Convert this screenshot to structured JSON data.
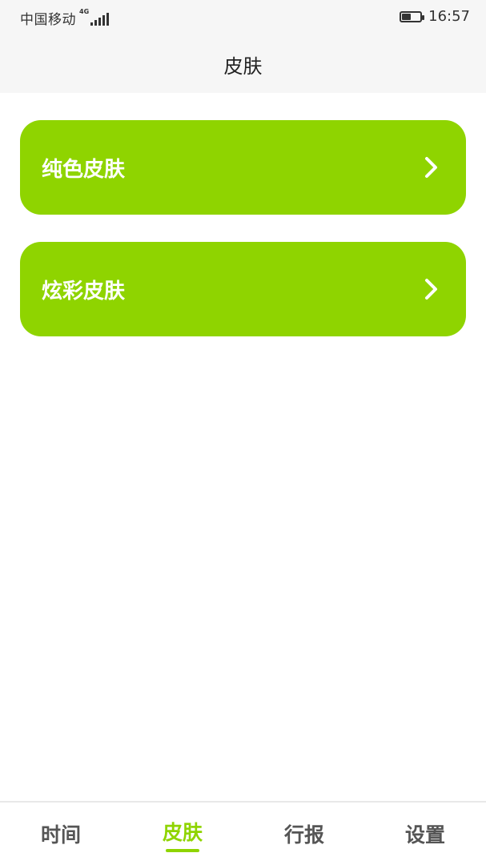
{
  "status_bar": {
    "carrier": "中国移动",
    "network": "4G",
    "time": "16:57",
    "battery_level": 0.5
  },
  "header": {
    "title": "皮肤"
  },
  "skin_options": [
    {
      "label": "纯色皮肤",
      "icon": "chevron-right-icon"
    },
    {
      "label": "炫彩皮肤",
      "icon": "chevron-right-icon"
    }
  ],
  "tabs": [
    {
      "label": "时间",
      "active": false
    },
    {
      "label": "皮肤",
      "active": true
    },
    {
      "label": "行报",
      "active": false
    },
    {
      "label": "设置",
      "active": false
    }
  ],
  "colors": {
    "accent": "#8fd400",
    "header_bg": "#f6f6f6",
    "text_dark": "#222222",
    "tab_inactive": "#555555"
  }
}
